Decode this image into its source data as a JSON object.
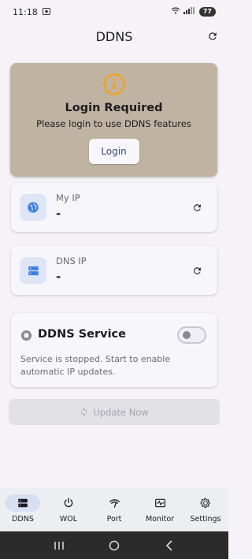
{
  "status_bar": {
    "time": "11:18",
    "battery": "77",
    "right_icons": [
      "wifi-icon",
      "signal-icon",
      "battery-icon"
    ],
    "left_icons": [
      "screenshot-icon"
    ]
  },
  "header": {
    "title": "DDNS",
    "refresh_icon": "refresh-icon"
  },
  "login_card": {
    "icon": "info-icon",
    "title": "Login Required",
    "subtitle": "Please login to use DDNS features",
    "button_label": "Login",
    "background": "#c0b3a2",
    "accent": "#f2a31c"
  },
  "my_ip": {
    "icon": "globe-icon",
    "label": "My IP",
    "value": "-"
  },
  "dns_ip": {
    "icon": "server-icon",
    "label": "DNS IP",
    "value": "-"
  },
  "service": {
    "icon": "stop-icon",
    "title": "DDNS Service",
    "toggle_on": false,
    "description": "Service is stopped. Start to enable automatic IP updates."
  },
  "update_button": {
    "label": "Update Now",
    "icon": "sync-icon",
    "enabled": false
  },
  "bottom_nav": {
    "items": [
      {
        "label": "DDNS",
        "icon": "server-icon",
        "active": true
      },
      {
        "label": "WOL",
        "icon": "power-icon",
        "active": false
      },
      {
        "label": "Port",
        "icon": "port-icon",
        "active": false
      },
      {
        "label": "Monitor",
        "icon": "monitor-icon",
        "active": false
      },
      {
        "label": "Settings",
        "icon": "gear-icon",
        "active": false
      }
    ]
  },
  "colors": {
    "primary": "#3f7fe0",
    "icon_bg": "#dde5f6",
    "active_nav": "#d7dff2"
  }
}
